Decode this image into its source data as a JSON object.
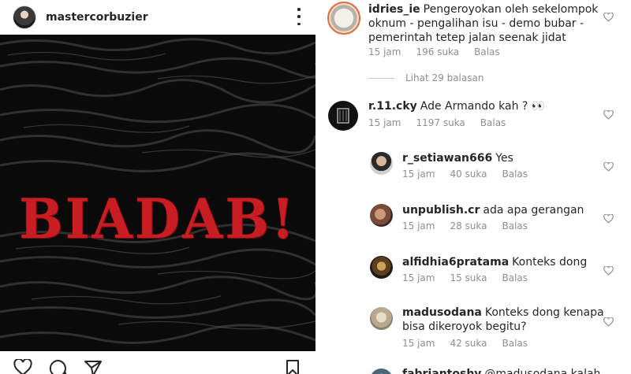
{
  "post": {
    "username": "mastercorbuzier",
    "image_text": "BIADAB!"
  },
  "comments": [
    {
      "username": "idries_ie",
      "text_line1": "Pengeroyokan oleh sekelompok",
      "text_line2": "oknum - pengalihan isu - demo bubar -",
      "text_line3": "pemerintah tetep jalan seenak jidat",
      "time": "15 jam",
      "likes": "196 suka",
      "reply": "Balas"
    },
    {
      "username": "r.11.cky",
      "text_line1": "Ade Armando kah ? 👀",
      "time": "15 jam",
      "likes": "1197 suka",
      "reply": "Balas"
    }
  ],
  "view_replies": "Lihat 29 balasan",
  "replies": [
    {
      "username": "r_setiawan666",
      "text_line1": "Yes",
      "time": "15 jam",
      "likes": "40 suka",
      "reply": "Balas"
    },
    {
      "username": "unpublish.cr",
      "text_line1": "ada apa gerangan",
      "time": "15 jam",
      "likes": "28 suka",
      "reply": "Balas"
    },
    {
      "username": "alfidhia6pratama",
      "text_line1": "Konteks dong",
      "time": "15 jam",
      "likes": "15 suka",
      "reply": "Balas"
    },
    {
      "username": "madusodana",
      "text_line1": "Konteks dong kenapa",
      "text_line2": "bisa dikeroyok begitu?",
      "time": "15 jam",
      "likes": "42 suka",
      "reply": "Balas"
    },
    {
      "username": "fabriantoshy",
      "text_line1": "@madusodana kalah",
      "time": "",
      "likes": "",
      "reply": ""
    }
  ],
  "icons": {
    "post_more": "more-options-icon",
    "like": "heart-icon",
    "comment": "comment-icon",
    "share": "share-icon",
    "save": "bookmark-icon",
    "comment_like": "heart-icon"
  },
  "colors": {
    "title_red": "#c81e23",
    "muted_text": "#8e8e8e",
    "text": "#262626"
  }
}
